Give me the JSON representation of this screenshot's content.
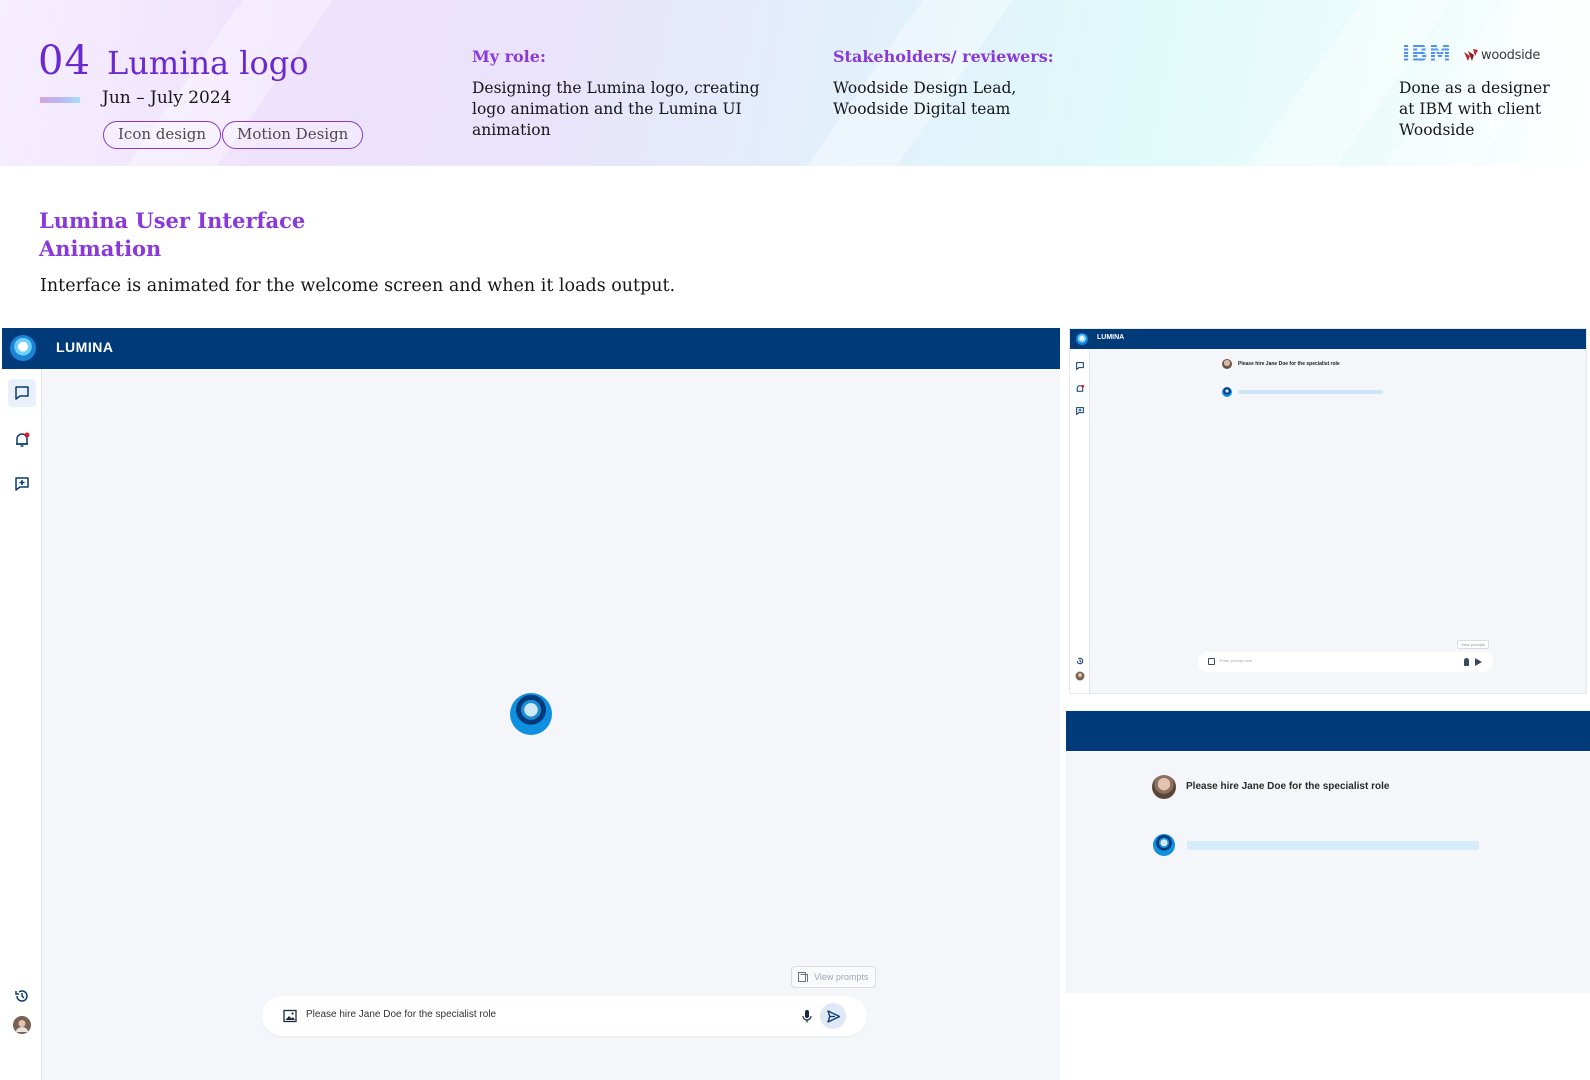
{
  "project": {
    "number": "04",
    "title": "Lumina logo",
    "date": "Jun – July 2024",
    "tags": [
      "Icon design",
      "Motion Design"
    ]
  },
  "role": {
    "label": "My role:",
    "text": "Designing the Lumina logo, creating logo animation and the Lumina UI animation"
  },
  "stakeholders": {
    "label": "Stakeholders/ reviewers:",
    "text": "Woodside Design Lead, Woodside Digital team"
  },
  "client": {
    "logos": [
      "IBM",
      "woodside"
    ],
    "text": "Done as a designer at IBM with client Woodside"
  },
  "section": {
    "title": "Lumina User Interface Animation",
    "description": "Interface is animated for the welcome screen and when it loads output."
  },
  "app": {
    "name": "LUMINA",
    "view_prompts": "View prompts",
    "prompt_value": "Please hire Jane Doe for the specialist role",
    "sidebar_icons": [
      "chat-icon",
      "notification-bell-icon",
      "new-chat-icon",
      "history-icon",
      "user-avatar"
    ]
  },
  "mini_app": {
    "name": "LUMINA",
    "message": "Please hire Jane Doe for the specialist role",
    "view_prompts": "View prompts",
    "prompt_placeholder": "Enter prompt here"
  },
  "zoom_app": {
    "message": "Please hire Jane Doe for the specialist role"
  },
  "colors": {
    "accent_purple": "#8a3ad8",
    "title_purple": "#6a2ad0",
    "app_navy": "#003a78",
    "app_blue": "#0f8fe0",
    "app_bg": "#f4f6f9"
  }
}
